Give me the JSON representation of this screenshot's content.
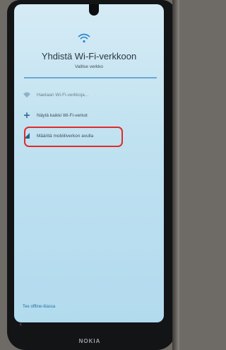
{
  "header": {
    "title": "Yhdistä Wi-Fi-verkkoon",
    "subtitle": "Valitse verkko"
  },
  "options": [
    {
      "icon": "wifi-search-icon",
      "label": "Haetaan Wi-Fi-verkkoja..."
    },
    {
      "icon": "plus-icon",
      "label": "Näytä kaikki Wi-Fi-verkot"
    },
    {
      "icon": "signal-icon",
      "label": "Määritä mobiiliverkon avulla"
    }
  ],
  "footer": {
    "offline_label": "Tee offline-tilassa"
  },
  "device": {
    "brand": "NOKIA",
    "back_glyph": "‹"
  },
  "colors": {
    "accent": "#2a87c8",
    "highlight": "#e02b2b"
  }
}
